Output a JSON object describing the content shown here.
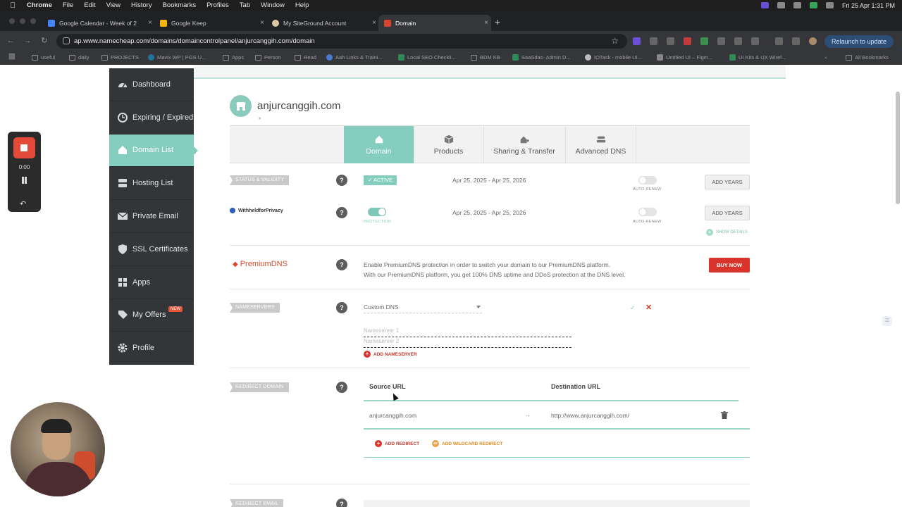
{
  "menubar": {
    "app": "Chrome",
    "items": [
      "File",
      "Edit",
      "View",
      "History",
      "Bookmarks",
      "Profiles",
      "Tab",
      "Window",
      "Help"
    ],
    "clock": "Fri 25 Apr  1:31 PM"
  },
  "tabs": [
    {
      "label": "Google Calendar - Week of 2",
      "color": "#4285f4"
    },
    {
      "label": "Google Keep",
      "color": "#f4b400"
    },
    {
      "label": "My SiteGround Account",
      "color": "#d9c9a2"
    },
    {
      "label": "Domain",
      "color": "#d9442f"
    }
  ],
  "address": {
    "url": "ap.www.namecheap.com/domains/domaincontrolpanel/anjurcanggih.com/domain",
    "relaunch": "Relaunch to update"
  },
  "bookmarks": [
    "useful",
    "daily",
    "PROJECTS",
    "Mavix WP | PGS U...",
    "Apps",
    "Person",
    "Read",
    "Aah Links & Traini...",
    "Local SEO Checkli...",
    "BDM KB",
    "SaaSdas- Admin D...",
    "IOTask - mobile UI...",
    "Untitled UI – Figm...",
    "UI Kits & UX Wiref..."
  ],
  "bookmarks_all": "All Bookmarks",
  "recorder": {
    "time": "0:00"
  },
  "nav": [
    {
      "label": "Dashboard",
      "icon": "dashboard-icon"
    },
    {
      "label": "Expiring / Expired",
      "icon": "clock-icon"
    },
    {
      "label": "Domain List",
      "icon": "home-icon"
    },
    {
      "label": "Hosting List",
      "icon": "server-icon"
    },
    {
      "label": "Private Email",
      "icon": "email-icon"
    },
    {
      "label": "SSL Certificates",
      "icon": "shield-icon"
    },
    {
      "label": "Apps",
      "icon": "apps-icon"
    },
    {
      "label": "My Offers",
      "icon": "tag-icon",
      "badge": "NEW"
    },
    {
      "label": "Profile",
      "icon": "gear-icon"
    }
  ],
  "domain": {
    "name": "anjurcanggih.com"
  },
  "content_tabs": [
    "Domain",
    "Products",
    "Sharing & Transfer",
    "Advanced DNS"
  ],
  "status": {
    "label": "STATUS & VALIDITY",
    "badge": "ACTIVE",
    "dates": "Apr 25, 2025 - Apr 25, 2026",
    "autorenew": "AUTO-RENEW",
    "button": "ADD YEARS"
  },
  "privacy": {
    "brand": "WithheldforPrivacy",
    "protection": "PROTECTION",
    "dates": "Apr 25, 2025 - Apr 25, 2026",
    "autorenew": "AUTO-RENEW",
    "button": "ADD YEARS",
    "details": "SHOW DETAILS"
  },
  "premiumdns": {
    "brand": "PremiumDNS",
    "line1": "Enable PremiumDNS protection in order to switch your domain to our PremiumDNS platform.",
    "line2": "With our PremiumDNS platform, you get 100% DNS uptime and DDoS protection at the DNS level.",
    "button": "BUY NOW"
  },
  "nameservers": {
    "label": "NAMESERVERS",
    "select": "Custom DNS",
    "ns1_placeholder": "Nameserver 1",
    "ns2_placeholder": "Nameserver 2",
    "add": "ADD NAMESERVER"
  },
  "redirect": {
    "label": "REDIRECT DOMAIN",
    "source_header": "Source URL",
    "dest_header": "Destination URL",
    "source": "anjurcanggih.com",
    "arrow": "→",
    "destination": "http://www.anjurcanggih.com/",
    "add": "ADD REDIRECT",
    "add_wildcard": "ADD WILDCARD REDIRECT"
  },
  "redirect_email": {
    "label": "REDIRECT EMAIL"
  }
}
